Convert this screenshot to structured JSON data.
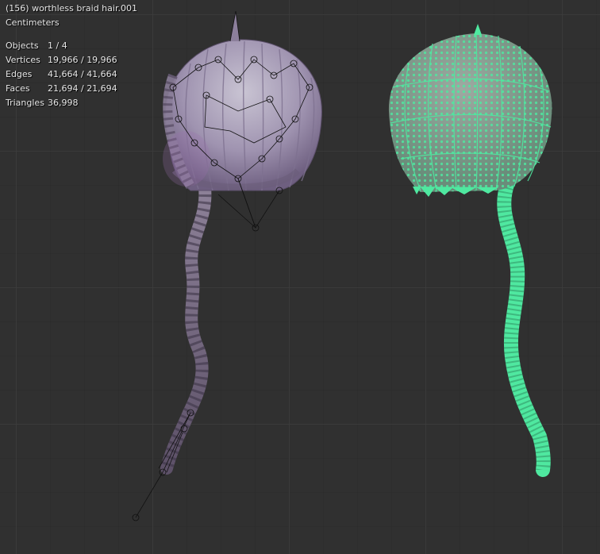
{
  "viewport": {
    "object_title": "(156) worthless braid hair.001",
    "units": "Centimeters",
    "stats": [
      {
        "label": "Objects",
        "value": "1 / 4"
      },
      {
        "label": "Vertices",
        "value": "19,966 / 19,966"
      },
      {
        "label": "Edges",
        "value": "41,664 / 41,664"
      },
      {
        "label": "Faces",
        "value": "21,694 / 21,694"
      },
      {
        "label": "Triangles",
        "value": "36,998"
      }
    ]
  },
  "colors": {
    "background": "#303030",
    "grid": "#3c3c3c",
    "hair_mesh": "#a89bb8",
    "selected_vertices": "#4fe8a0",
    "armature": "#000000"
  }
}
